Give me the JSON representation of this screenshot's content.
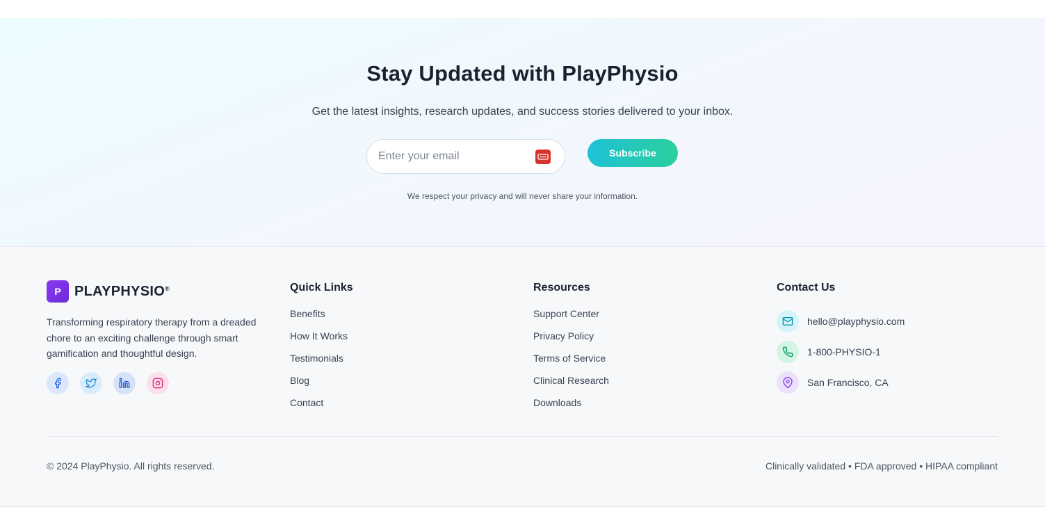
{
  "newsletter": {
    "title": "Stay Updated with PlayPhysio",
    "subtitle": "Get the latest insights, research updates, and success stories delivered to your inbox.",
    "email_placeholder": "Enter your email",
    "email_value": "",
    "subscribe_label": "Subscribe",
    "privacy_note": "We respect your privacy and will never share your information.",
    "password_manager_icon": "password-manager-icon"
  },
  "brand": {
    "logo_letter": "P",
    "name": "PLAYPHYSIO",
    "trademark": "®",
    "description": "Transforming respiratory therapy from a dreaded chore to an exciting challenge through smart gamification and thoughtful design."
  },
  "socials": [
    {
      "icon": "facebook-icon",
      "bg": "#dbe8fa",
      "color": "#2563eb"
    },
    {
      "icon": "twitter-icon",
      "bg": "#d8ecf9",
      "color": "#1d8fd8"
    },
    {
      "icon": "linkedin-icon",
      "bg": "#d5e3f6",
      "color": "#1d4ed8"
    },
    {
      "icon": "instagram-icon",
      "bg": "#fbe0ec",
      "color": "#db2777"
    }
  ],
  "quick_links": {
    "title": "Quick Links",
    "items": [
      "Benefits",
      "How It Works",
      "Testimonials",
      "Blog",
      "Contact"
    ]
  },
  "resources": {
    "title": "Resources",
    "items": [
      "Support Center",
      "Privacy Policy",
      "Terms of Service",
      "Clinical Research",
      "Downloads"
    ]
  },
  "contact": {
    "title": "Contact Us",
    "items": [
      {
        "icon": "mail-icon",
        "text": "hello@playphysio.com",
        "bg": "#d4f4f9",
        "color": "#0891b2"
      },
      {
        "icon": "phone-icon",
        "text": "1-800-PHYSIO-1",
        "bg": "#d3f5e3",
        "color": "#059669"
      },
      {
        "icon": "map-pin-icon",
        "text": "San Francisco, CA",
        "bg": "#ece0fb",
        "color": "#7c3aed"
      }
    ]
  },
  "footer_bottom": {
    "copyright": "© 2024 PlayPhysio. All rights reserved.",
    "badges": "Clinically validated • FDA approved • HIPAA compliant"
  },
  "colors": {
    "accent_gradient_start": "#1fc1d6",
    "accent_gradient_end": "#2bcf9c",
    "brand_purple": "#7c3aed",
    "heading": "#1a2230"
  }
}
